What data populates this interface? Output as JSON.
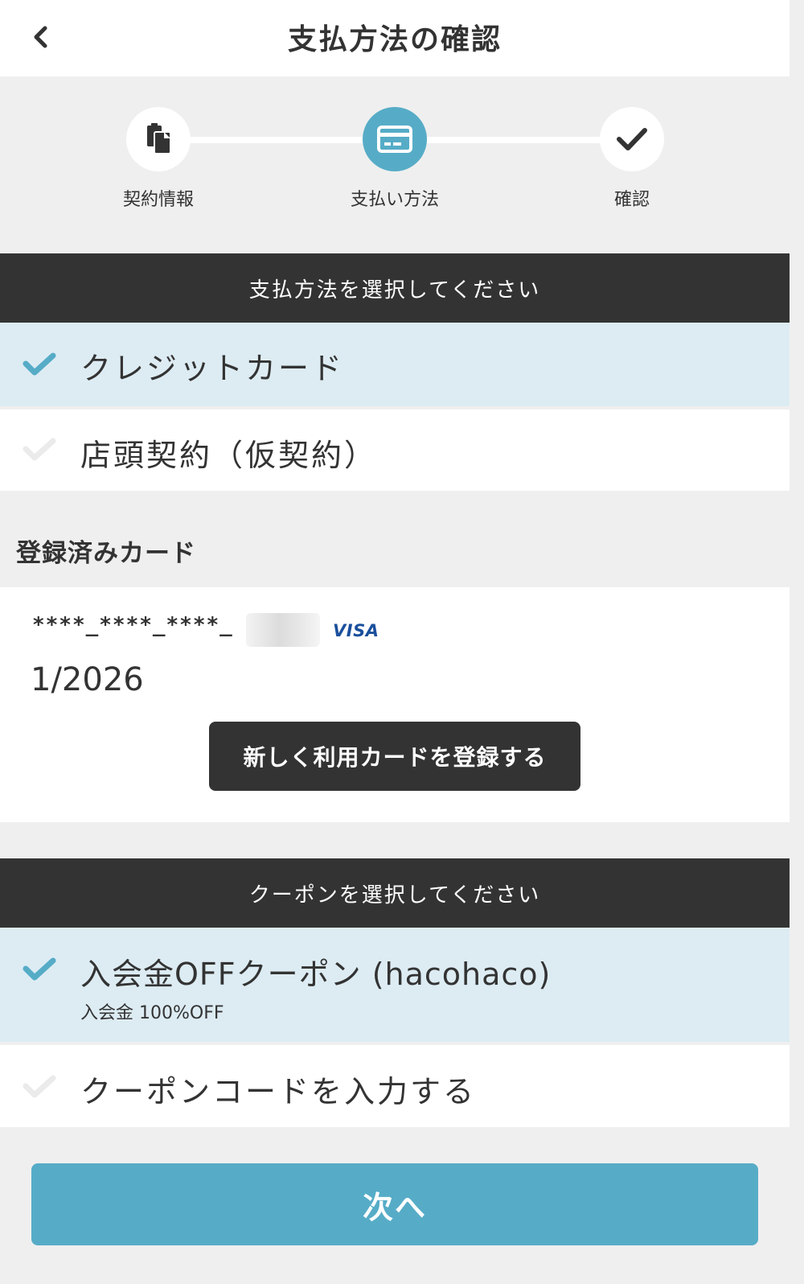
{
  "header": {
    "title": "支払方法の確認",
    "back_icon": "chevron-left-icon"
  },
  "stepper": {
    "steps": [
      {
        "label": "契約情報",
        "icon": "clipboard-icon",
        "state": "done"
      },
      {
        "label": "支払い方法",
        "icon": "credit-card-icon",
        "state": "active"
      },
      {
        "label": "確認",
        "icon": "check-icon",
        "state": "pending"
      }
    ]
  },
  "payment": {
    "section_title": "支払方法を選択してください",
    "options": [
      {
        "label": "クレジットカード",
        "selected": true
      },
      {
        "label": "店頭契約（仮契約）",
        "selected": false
      }
    ]
  },
  "registered_cards": {
    "heading": "登録済みカード",
    "card_number": "****_****_****_",
    "card_brand": "VISA",
    "card_expiry": "1/2026",
    "register_button": "新しく利用カードを登録する"
  },
  "coupon": {
    "section_title": "クーポンを選択してください",
    "options": [
      {
        "label": "入会金OFFクーポン (hacohaco)",
        "sub": "入会金 100%OFF",
        "selected": true
      },
      {
        "label": "クーポンコードを入力する",
        "selected": false
      }
    ]
  },
  "footer": {
    "next_button": "次へ"
  },
  "colors": {
    "accent": "#56acc7",
    "dark": "#333333",
    "selected_bg": "#ddecf3",
    "page_bg": "#efefef"
  }
}
